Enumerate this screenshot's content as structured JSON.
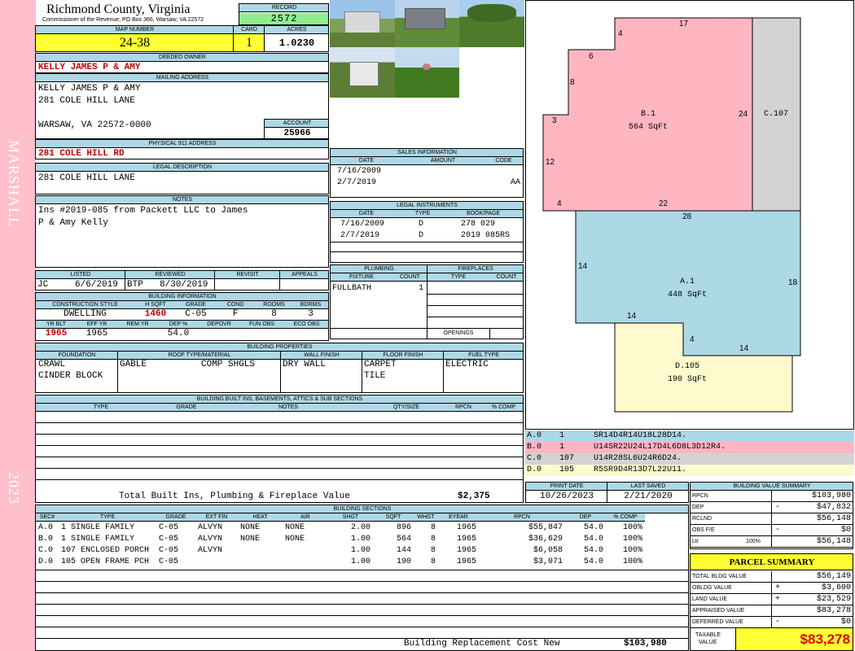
{
  "county": {
    "name": "Richmond County, Virginia",
    "commissioner": "Commissioner of the Revenue, PO Box 366, Warsaw, VA 22572"
  },
  "record": {
    "label": "RECORD",
    "value": "2572"
  },
  "map": {
    "label": "MAP NUMBER",
    "value": "24-38"
  },
  "card": {
    "label": "CARD",
    "value": "1"
  },
  "acres": {
    "label": "ACRES",
    "value": "1.0230"
  },
  "owner": {
    "label": "DEEDED OWNER",
    "value": "KELLY JAMES P & AMY"
  },
  "mailing": {
    "label": "MAILING ADDRESS",
    "line1": "KELLY JAMES P & AMY",
    "line2": "281 COLE HILL LANE",
    "line3": "WARSAW, VA 22572-0000"
  },
  "account": {
    "label": "ACCOUNT",
    "value": "25966"
  },
  "physical": {
    "label": "PHYSICAL 911 ADDRESS",
    "value": "281 COLE HILL RD"
  },
  "legal": {
    "label": "LEGAL DESCRIPTION",
    "value": "281 COLE HILL LANE"
  },
  "notes": {
    "label": "NOTES",
    "line1": "Ins #2019-085 from Packett LLC to James",
    "line2": "P & Amy Kelly"
  },
  "review": {
    "listed_label": "LISTED",
    "reviewed_label": "REVIEWED",
    "revisit_label": "REVISIT",
    "appeals_label": "APPEALS",
    "listed_by": "JC",
    "listed_date": "6/6/2019",
    "reviewed_by": "BTP",
    "reviewed_date": "8/30/2019"
  },
  "building": {
    "title": "BUILDING INFORMATION",
    "h_style": "CONSTRUCTION STYLE",
    "h_sqft": "H SQFT",
    "h_grade": "GRADE",
    "h_cond": "COND",
    "h_rooms": "ROOMS",
    "h_bdrms": "BDRMS",
    "style": "DWELLING",
    "sqft": "1460",
    "grade": "C-05",
    "cond": "F",
    "rooms": "8",
    "bdrms": "3",
    "h_yrblt": "YR BLT",
    "h_effyr": "EFF YR",
    "h_remyr": "REM YR",
    "h_dep": "DEP %",
    "h_depovr": "DEPOVR",
    "h_funobs": "FUN OBS",
    "h_ecoobs": "ECO OBS",
    "yrblt": "1965",
    "effyr": "1965",
    "dep": "54.0"
  },
  "sales": {
    "title": "SALES INFORMATION",
    "h_date": "DATE",
    "h_amount": "AMOUNT",
    "h_code": "CODE",
    "rows": [
      {
        "date": "7/16/2009",
        "amount": "",
        "code": ""
      },
      {
        "date": "2/7/2019",
        "amount": "",
        "code": "AA"
      }
    ]
  },
  "instruments": {
    "title": "LEGAL INSTRUMENTS",
    "h_date": "DATE",
    "h_type": "TYPE",
    "h_book": "BOOK/PAGE",
    "rows": [
      {
        "date": "7/16/2009",
        "type": "D",
        "book": "278 029"
      },
      {
        "date": "2/7/2019",
        "type": "D",
        "book": "2019 085RS"
      }
    ]
  },
  "plumbing": {
    "title": "PLUMBING",
    "h_fixture": "FIXTURE",
    "h_count": "COUNT",
    "fixture": "FULLBATH",
    "count": "1"
  },
  "fireplaces": {
    "title": "FIREPLACES",
    "h_type": "TYPE",
    "h_count": "COUNT",
    "openings": "OPENINGS"
  },
  "properties": {
    "title": "BUILDING PROPERTIES",
    "h_found": "FOUNDATION",
    "h_roof": "ROOF TYPE/MATERIAL",
    "h_wall": "WALL FINISH",
    "h_floor": "FLOOR FINISH",
    "h_fuel": "FUEL TYPE",
    "found1": "CRAWL",
    "found2": "CINDER BLOCK",
    "roof1": "GABLE",
    "roof2": "COMP SHGLS",
    "wall": "DRY WALL",
    "floor1": "CARPET",
    "floor2": "TILE",
    "fuel": "ELECTRIC"
  },
  "builtins": {
    "title": "BUILDING BUILT INS, BASEMENTS, ATTICS & SUB SECTIONS",
    "h_type": "TYPE",
    "h_grade": "GRADE",
    "h_notes": "NOTES",
    "h_qty": "QTY/SIZE",
    "h_rpcn": "RPCN",
    "h_comp": "% COMP",
    "total_label": "Total Built Ins, Plumbing & Fireplace Value",
    "total_value": "$2,375"
  },
  "sections": {
    "title": "BUILDING SECTIONS",
    "headers": [
      "SEC#",
      "TYPE",
      "GRADE",
      "EXT FIN",
      "HEAT",
      "AIR",
      "SHGT",
      "SQFT",
      "WHGT",
      "EYEAR",
      "RPCN",
      "DEP",
      "% COMP"
    ],
    "rows": [
      {
        "sec": "A.0",
        "type": "1 SINGLE FAMILY",
        "grade": "C-05",
        "ext": "ALVYN",
        "heat": "NONE",
        "air": "NONE",
        "shgt": "2.00",
        "sqft": "896",
        "whgt": "8",
        "eyear": "1965",
        "rpcn": "$55,847",
        "dep": "54.0",
        "comp": "100%"
      },
      {
        "sec": "B.0",
        "type": "1 SINGLE FAMILY",
        "grade": "C-05",
        "ext": "ALVYN",
        "heat": "NONE",
        "air": "NONE",
        "shgt": "1.00",
        "sqft": "564",
        "whgt": "8",
        "eyear": "1965",
        "rpcn": "$36,629",
        "dep": "54.0",
        "comp": "100%"
      },
      {
        "sec": "C.0",
        "type": "107 ENCLOSED PORCH",
        "grade": "C-05",
        "ext": "ALVYN",
        "heat": "",
        "air": "",
        "shgt": "1.00",
        "sqft": "144",
        "whgt": "8",
        "eyear": "1965",
        "rpcn": "$6,058",
        "dep": "54.0",
        "comp": "100%"
      },
      {
        "sec": "D.0",
        "type": "105 OPEN FRAME PCH",
        "grade": "C-05",
        "ext": "",
        "heat": "",
        "air": "",
        "shgt": "1.00",
        "sqft": "190",
        "whgt": "8",
        "eyear": "1965",
        "rpcn": "$3,071",
        "dep": "54.0",
        "comp": "100%"
      }
    ],
    "replacement_label": "Building Replacement Cost New",
    "replacement_value": "$103,980"
  },
  "sketch": {
    "b_name": "B.1",
    "b_area": "564 SqFt",
    "c_name": "C.107",
    "a_name": "A.1",
    "a_area": "448 SqFt",
    "d_name": "D.105",
    "d_area": "190 SqFt",
    "dims": {
      "b17": "17",
      "b4t": "4",
      "b6": "6",
      "b8": "8",
      "b3": "3",
      "b12": "12",
      "b4b": "4",
      "b22": "22",
      "b24": "24",
      "a28": "28",
      "a14l": "14",
      "a18": "18",
      "a14b": "14",
      "d4": "4",
      "d14": "14"
    },
    "legend": [
      {
        "code": "A.0",
        "num": "1",
        "str": "SR14D4R14U18L28D14.",
        "color": "#add8e6"
      },
      {
        "code": "B.0",
        "num": "1",
        "str": "U14SR22U24L17D4L6D8L3D12R4.",
        "color": "#ffb6c1"
      },
      {
        "code": "C.0",
        "num": "107",
        "str": "U14R28SL6U24R6D24.",
        "color": "#d3d3d3"
      },
      {
        "code": "D.0",
        "num": "105",
        "str": "R5SR9D4R13D7L22U11.",
        "color": "#fffacd"
      }
    ]
  },
  "dates": {
    "print_label": "PRINT DATE",
    "print": "10/26/2023",
    "saved_label": "LAST SAVED",
    "saved": "2/21/2020"
  },
  "bvs": {
    "title": "BUILDING VALUE SUMMARY",
    "rows": [
      {
        "label": "RPCN",
        "sign": "",
        "value": "$103,980"
      },
      {
        "label": "DEP",
        "sign": "-",
        "value": "$47,832"
      },
      {
        "label": "RCLND",
        "sign": "",
        "value": "$56,148"
      },
      {
        "label": "OBS F/E",
        "sign": "-",
        "value": "$0"
      },
      {
        "label": "Ltr",
        "pct": "100%",
        "sign": "",
        "value": "$56,148"
      }
    ]
  },
  "parcel": {
    "title": "PARCEL SUMMARY",
    "rows": [
      {
        "label": "TOTAL BLDG VALUE",
        "sign": "",
        "value": "$56,149"
      },
      {
        "label": "OBLDG VALUE",
        "sign": "+",
        "value": "$3,600"
      },
      {
        "label": "LAND VALUE",
        "sign": "+",
        "value": "$23,529"
      },
      {
        "label": "APPRAISED VALUE",
        "sign": "",
        "value": "$83,278"
      },
      {
        "label": "DEFERRED VALUE",
        "sign": "-",
        "value": "$0"
      }
    ],
    "taxable_label1": "TAXABLE",
    "taxable_label2": "VALUE",
    "taxable": "$83,278"
  },
  "sidebar": {
    "name": "MARSHALL",
    "year": "2023"
  }
}
